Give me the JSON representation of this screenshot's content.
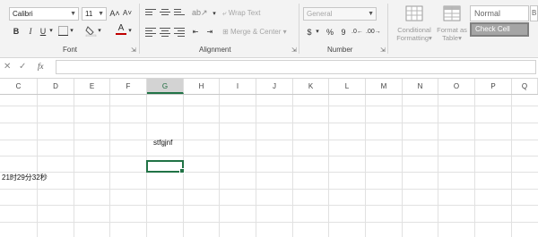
{
  "ribbon": {
    "font": {
      "name": "Calibri",
      "size": "11",
      "grow_icon": "A˄",
      "shrink_icon": "A˅",
      "bold": "B",
      "italic": "I",
      "underline": "U",
      "label": "Font"
    },
    "alignment": {
      "wrap_text": "Wrap Text",
      "merge_center": "Merge & Center",
      "label": "Alignment"
    },
    "number": {
      "format": "General",
      "currency": "$",
      "percent": "%",
      "comma": "9",
      "label": "Number"
    },
    "styles": {
      "conditional_formatting": [
        "Conditional",
        "Formatting"
      ],
      "format_as_table": [
        "Format as",
        "Table"
      ],
      "normal": "Normal",
      "check_cell": "Check Cell",
      "overflow_label": "B"
    }
  },
  "formula_bar": {
    "cancel": "✕",
    "enter": "✓",
    "function": "fx",
    "value": ""
  },
  "columns": [
    "C",
    "D",
    "E",
    "F",
    "G",
    "H",
    "I",
    "J",
    "K",
    "L",
    "M",
    "N",
    "O",
    "P",
    "Q"
  ],
  "active_column": "G",
  "cells": {
    "g4": "stfgjnf",
    "a6": "21时29分32秒"
  },
  "colors": {
    "accent": "#217346",
    "font_color_bar": "#c00000"
  }
}
